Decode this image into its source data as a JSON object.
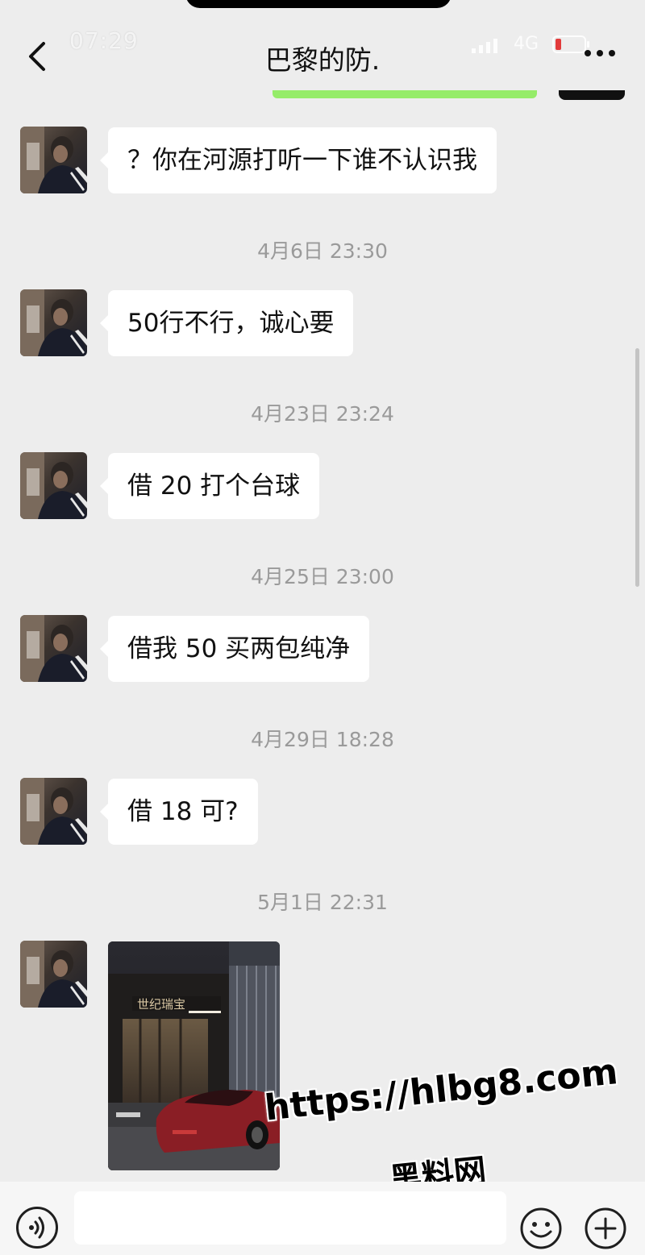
{
  "status_bar": {
    "time": "07:29",
    "network": "4G"
  },
  "header": {
    "title": "巴黎的防."
  },
  "messages": [
    {
      "type": "text",
      "text": "？你在河源打听一下谁不认识我"
    },
    {
      "type": "timestamp",
      "text": "4月6日 23:30"
    },
    {
      "type": "text",
      "text": "50行不行，诚心要"
    },
    {
      "type": "timestamp",
      "text": "4月23日 23:24"
    },
    {
      "type": "text",
      "text": "借 20 打个台球"
    },
    {
      "type": "timestamp",
      "text": "4月25日 23:00"
    },
    {
      "type": "text",
      "text": "借我 50 买两包纯净"
    },
    {
      "type": "timestamp",
      "text": "4月29日 18:28"
    },
    {
      "type": "text",
      "text": "借 18 可?"
    },
    {
      "type": "timestamp",
      "text": "5月1日 22:31"
    },
    {
      "type": "image",
      "sign_text": "世纪瑞宝"
    }
  ],
  "watermark": {
    "url": "https://hlbg8.com",
    "label": "黑料网"
  },
  "input_bar": {
    "placeholder": ""
  },
  "colors": {
    "background": "#ededed",
    "bubble": "#ffffff",
    "accent_green": "#95ec69",
    "timestamp": "#9a9a9a"
  },
  "icons": [
    "back-arrow-icon",
    "more-dots-icon",
    "voice-icon",
    "emoji-icon",
    "plus-icon",
    "signal-icon",
    "battery-icon"
  ]
}
